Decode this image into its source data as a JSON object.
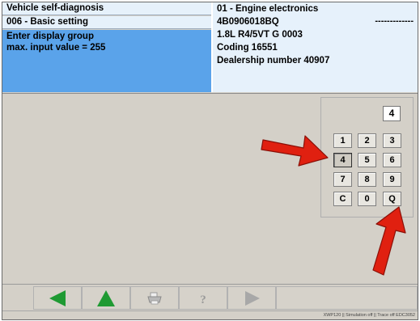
{
  "header": {
    "left_line1": "Vehicle self-diagnosis",
    "left_line2": "006 - Basic setting",
    "prompt_line1": "Enter display group",
    "prompt_line2": "max. input value = 255",
    "right_line1": "01 - Engine electronics",
    "right_line2": "4B0906018BQ",
    "right_line2_dashes": "-------------",
    "right_line3": "1.8L R4/5VT    G  0003",
    "right_line4": "Coding 16551",
    "right_line5": "Dealership number 40907"
  },
  "keypad": {
    "display_value": "4",
    "keys": [
      "1",
      "2",
      "3",
      "4",
      "5",
      "6",
      "7",
      "8",
      "9",
      "C",
      "0",
      "Q"
    ],
    "pressed_key": "4"
  },
  "annotations": {
    "arrow_color": "#e02010",
    "arrows": [
      "pointing-to-key-4",
      "pointing-to-key-Q"
    ]
  },
  "toolbar": {
    "buttons": [
      "back-arrow-icon",
      "up-arrow-icon",
      "print-icon",
      "help-icon",
      "forward-arrow-icon"
    ],
    "green": "#1f9a33"
  },
  "status": {
    "text": "XWP120  ||  Simulation off  ||  Trace off  EDC3052"
  }
}
